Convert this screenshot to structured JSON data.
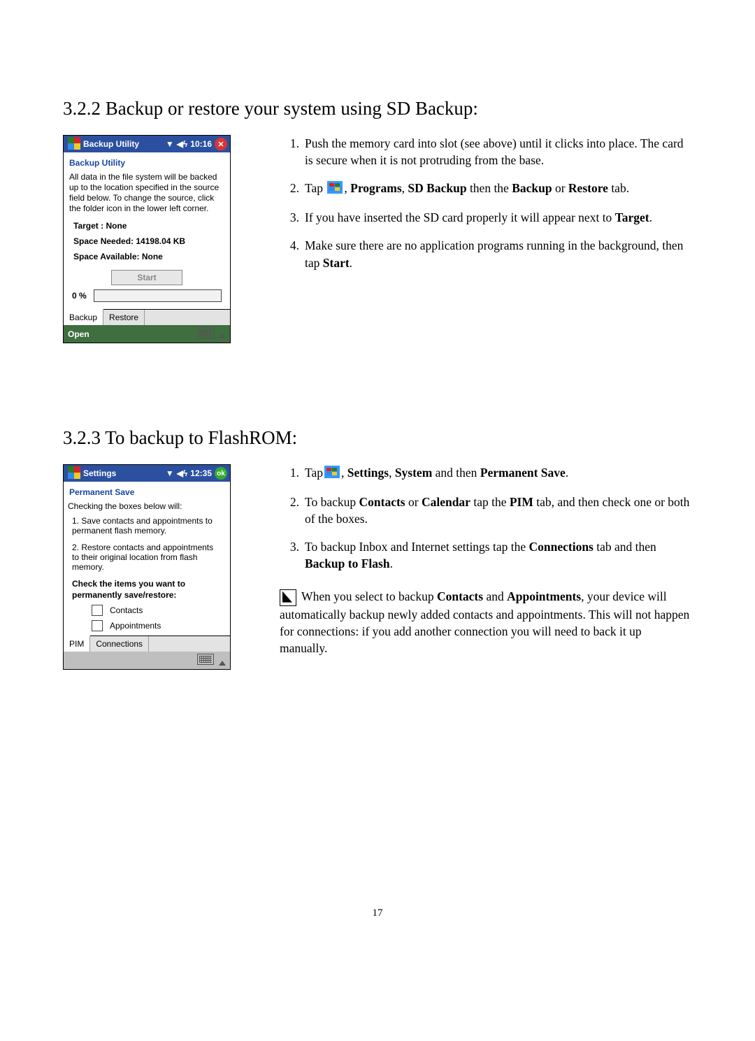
{
  "sections": [
    {
      "id": "backup_restore",
      "heading": "3.2.2 Backup or restore your system using SD Backup:",
      "screenshot": {
        "titlebar": {
          "app_title": "Backup Utility",
          "clock": "10:16"
        },
        "sub_heading": "Backup Utility",
        "description": "All data in the file system will be backed up to the location specified in the source field below. To change the source, click the folder icon in the lower left corner.",
        "target_label": "Target : None",
        "space_needed": "Space Needed: 14198.04 KB",
        "space_available": "Space Available: None",
        "start_button": "Start",
        "progress_text": "0 %",
        "tabs": [
          "Backup",
          "Restore"
        ],
        "softbar_left": "Open"
      },
      "instructions": [
        {
          "num": "1.",
          "text_before": "Push the memory card into slot (see above) until it clicks into place. The card is secure when it is not protruding from the base."
        },
        {
          "num": "2.",
          "text_before": "Tap ",
          "has_flag_icon": true,
          "text_after_icon": ", ",
          "bold_parts": [
            "Programs",
            "SD Backup",
            "Backup",
            "Restore"
          ],
          "full_sentence": "Programs, SD Backup then the Backup or Restore tab."
        },
        {
          "num": "3.",
          "text_before": "If you have inserted the SD card properly it will appear next to ",
          "bold_tail": "Target",
          "punct": "."
        },
        {
          "num": "4.",
          "text_before": "Make sure there are no application programs running in the background, then tap ",
          "bold_tail": "Start",
          "punct": "."
        }
      ]
    },
    {
      "id": "flashrom",
      "heading": "3.2.3 To backup to FlashROM:",
      "screenshot": {
        "titlebar": {
          "app_title": "Settings",
          "clock": "12:35"
        },
        "sub_heading": "Permanent Save",
        "intro": "Checking the boxes below will:",
        "item1": "1. Save contacts and appointments to permanent flash memory.",
        "item2": "2. Restore contacts and appointments to their original location from flash memory.",
        "check_label_heading": "Check the items you want to permanently save/restore:",
        "checks": [
          "Contacts",
          "Appointments"
        ],
        "tabs": [
          "PIM",
          "Connections"
        ]
      },
      "instructions": [
        {
          "num": "1.",
          "lead": "Tap",
          "bold_parts": [
            "Settings",
            "System",
            "Permanent Save"
          ]
        },
        {
          "num": "2.",
          "text_a": "To backup ",
          "bold_a": "Contacts",
          "text_b": " or ",
          "bold_b": "Calendar",
          "text_c": " tap the ",
          "bold_c": "PIM",
          "text_d": " tab, and then check one or both of the boxes."
        },
        {
          "num": "3.",
          "text_a": "To backup Inbox and Internet settings tap the ",
          "bold_a": "Connections",
          "text_b": " tab and then ",
          "bold_b": "Backup to Flash",
          "text_c": "."
        }
      ],
      "note": {
        "text_a": " When you select to backup ",
        "bold_a": "Contacts",
        "text_b": " and ",
        "bold_b": "Appointments",
        "text_c": ", your device will automatically backup newly added contacts and appointments. This will not happen for connections: if you add another connection you will need to back it up manually."
      }
    }
  ],
  "page_number": "17"
}
